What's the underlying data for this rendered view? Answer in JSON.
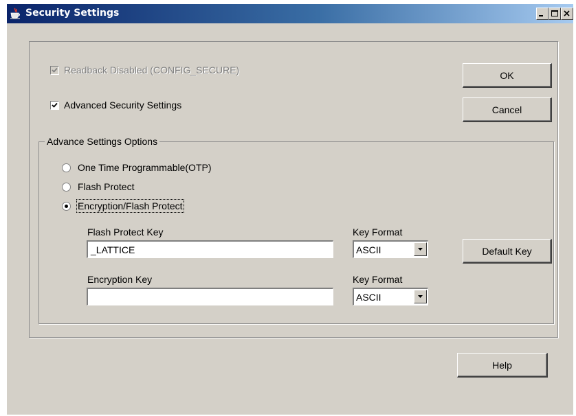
{
  "window": {
    "title": "Security Settings",
    "icon": "java-cup-icon"
  },
  "checkboxes": {
    "readback": {
      "label": "Readback Disabled (CONFIG_SECURE)",
      "checked": true,
      "enabled": false
    },
    "advanced": {
      "label": "Advanced Security Settings",
      "checked": true,
      "enabled": true
    }
  },
  "buttons": {
    "ok": "OK",
    "cancel": "Cancel",
    "default_key": "Default Key",
    "help": "Help"
  },
  "group": {
    "title": "Advance Settings Options",
    "options": [
      {
        "label": "One Time Programmable(OTP)",
        "selected": false
      },
      {
        "label": "Flash Protect",
        "selected": false
      },
      {
        "label": "Encryption/Flash Protect",
        "selected": true
      }
    ]
  },
  "flash_protect_key": {
    "label": "Flash Protect Key",
    "value": "_LATTICE",
    "format_label": "Key Format",
    "format_value": "ASCII"
  },
  "encryption_key": {
    "label": "Encryption Key",
    "value": "",
    "format_label": "Key Format",
    "format_value": "ASCII"
  }
}
